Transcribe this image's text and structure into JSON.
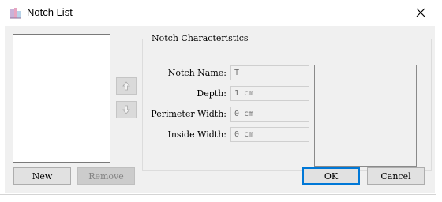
{
  "window": {
    "title": "Notch List"
  },
  "group": {
    "label": "Notch Characteristics",
    "fields": [
      {
        "label": "Notch Name:",
        "value": "T"
      },
      {
        "label": "Depth:",
        "value": "1 cm"
      },
      {
        "label": "Perimeter Width:",
        "value": "0 cm"
      },
      {
        "label": "Inside Width:",
        "value": "0 cm"
      }
    ]
  },
  "buttons": {
    "new": "New",
    "remove": "Remove",
    "ok": "OK",
    "cancel": "Cancel"
  },
  "icons": {
    "app": "notch-app-icon",
    "close": "close-icon",
    "up": "arrow-up-icon",
    "down": "arrow-down-icon"
  },
  "colors": {
    "accent": "#0078d7",
    "background": "#f0f0f0"
  }
}
